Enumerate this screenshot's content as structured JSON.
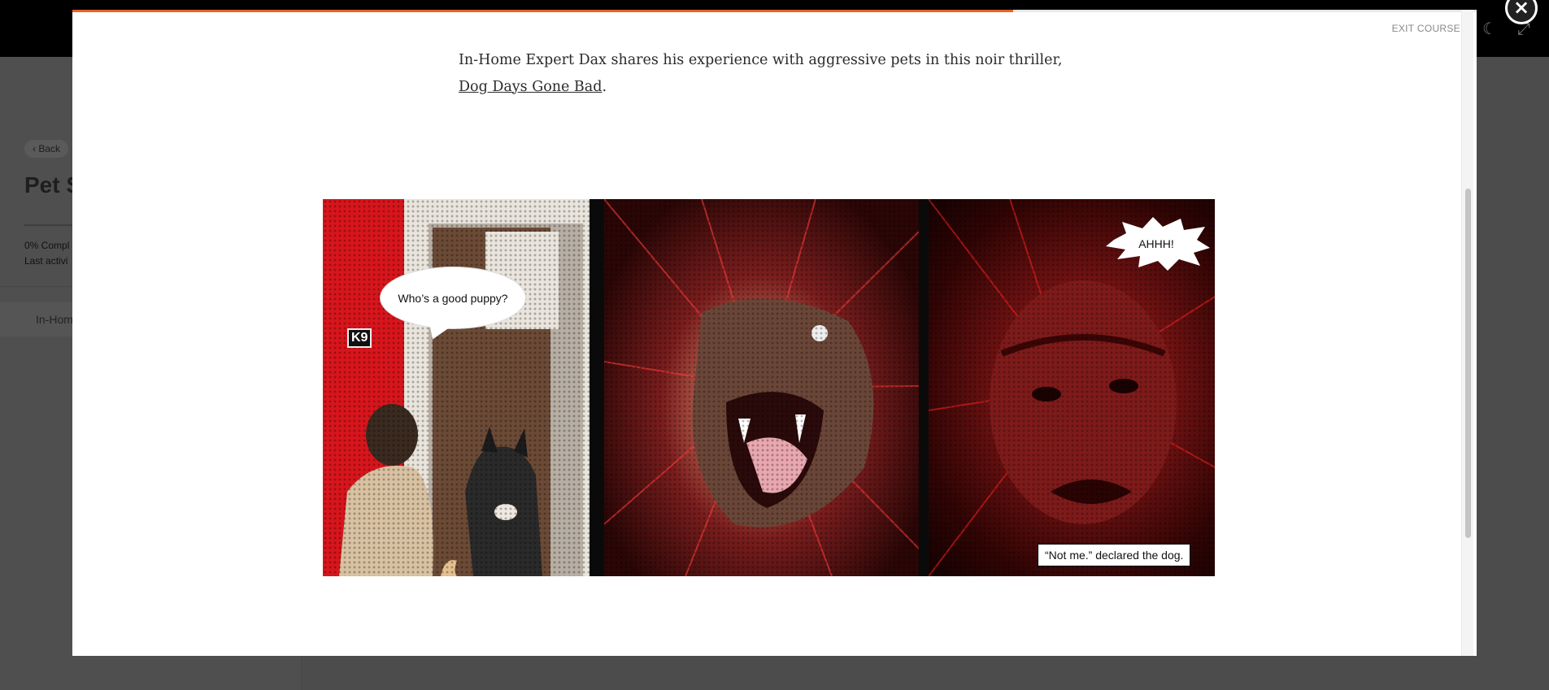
{
  "background": {
    "back_label": "‹ Back",
    "course_title": "Pet S",
    "progress_line1": "0% Compl",
    "progress_line2": "Last activi",
    "lesson_label": "In-Hom"
  },
  "topbar": {
    "icons": [
      "moon-icon",
      "expand-icon"
    ]
  },
  "modal": {
    "progress_percent": 67,
    "exit_label": "EXIT COURSE",
    "intro_text": "In-Home Expert Dax shares his experience with aggressive pets in this noir thriller, ",
    "intro_link": "Dog Days Gone Bad",
    "intro_end": "."
  },
  "comic": {
    "panel1_bubble": "Who’s a good puppy?",
    "panel1_sign": "K9",
    "panel3_shout": "AHHH!",
    "panel3_caption": "“Not me.” declared the dog."
  },
  "colors": {
    "accent": "#e8622a",
    "overlay": "#4d4d4d",
    "comic_red": "#d8151c"
  }
}
